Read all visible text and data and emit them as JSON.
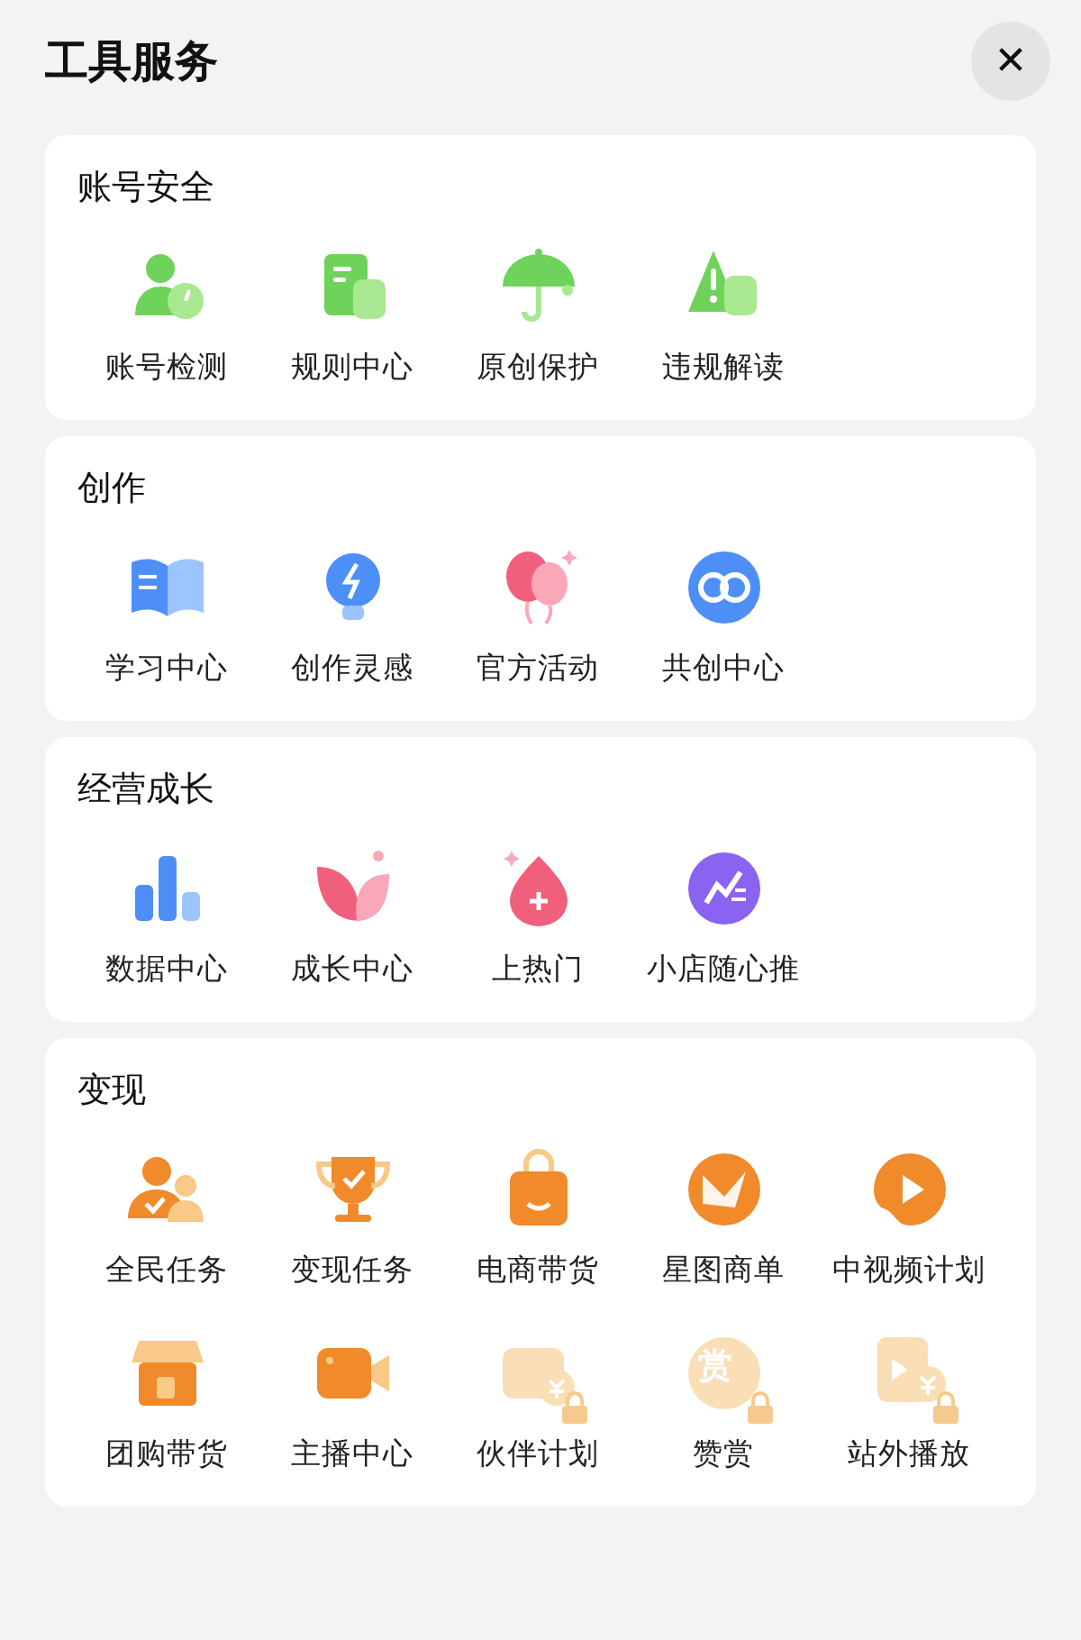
{
  "title": "工具服务",
  "close_button": "✕",
  "sections": [
    {
      "title": "账号安全",
      "items": [
        {
          "label": "账号检测",
          "locked": false
        },
        {
          "label": "规则中心",
          "locked": false
        },
        {
          "label": "原创保护",
          "locked": false
        },
        {
          "label": "违规解读",
          "locked": false
        }
      ]
    },
    {
      "title": "创作",
      "items": [
        {
          "label": "学习中心",
          "locked": false
        },
        {
          "label": "创作灵感",
          "locked": false
        },
        {
          "label": "官方活动",
          "locked": false
        },
        {
          "label": "共创中心",
          "locked": false
        }
      ]
    },
    {
      "title": "经营成长",
      "items": [
        {
          "label": "数据中心",
          "locked": false
        },
        {
          "label": "成长中心",
          "locked": false
        },
        {
          "label": "上热门",
          "locked": false
        },
        {
          "label": "小店随心推",
          "locked": false
        }
      ]
    },
    {
      "title": "变现",
      "items": [
        {
          "label": "全民任务",
          "locked": false
        },
        {
          "label": "变现任务",
          "locked": false
        },
        {
          "label": "电商带货",
          "locked": false
        },
        {
          "label": "星图商单",
          "locked": false
        },
        {
          "label": "中视频计划",
          "locked": false
        },
        {
          "label": "团购带货",
          "locked": false
        },
        {
          "label": "主播中心",
          "locked": false
        },
        {
          "label": "伙伴计划",
          "locked": true
        },
        {
          "label": "赞赏",
          "locked": true,
          "icon_text": "赏"
        },
        {
          "label": "站外播放",
          "locked": true
        }
      ]
    }
  ]
}
